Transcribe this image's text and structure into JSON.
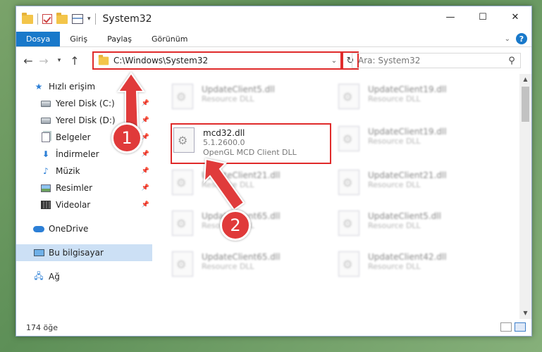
{
  "window": {
    "title": "System32",
    "controls": {
      "minimize": "—",
      "maximize": "☐",
      "close": "✕"
    }
  },
  "ribbon": {
    "tabs": [
      "Dosya",
      "Giriş",
      "Paylaş",
      "Görünüm"
    ],
    "help": "?"
  },
  "address": {
    "path": "C:\\Windows\\System32",
    "search_placeholder": "Ara: System32"
  },
  "sidebar": {
    "quick_access": "Hızlı erişim",
    "pinned": [
      "Yerel Disk (C:)",
      "Yerel Disk (D:)",
      "Belgeler",
      "İndirmeler",
      "Müzik",
      "Resimler",
      "Videolar"
    ],
    "onedrive": "OneDrive",
    "this_pc": "Bu bilgisayar",
    "network": "Ağ"
  },
  "files": {
    "highlighted": {
      "name": "mcd32.dll",
      "version": "5.1.2600.0",
      "description": "OpenGL MCD Client DLL"
    },
    "left_column": [
      {
        "name": "UpdateClient5.dll",
        "type": "Resource DLL"
      },
      {
        "name": "UpdateClient21.dll",
        "type": "Resource DLL"
      },
      {
        "name": "UpdateClient65.dll",
        "type": "Resource DLL"
      },
      {
        "name": "UpdateClient65.dll",
        "type": "Resource DLL"
      }
    ],
    "right_column": [
      {
        "name": "UpdateClient19.dll",
        "type": "Resource DLL"
      },
      {
        "name": "UpdateClient19.dll",
        "type": "Resource DLL"
      },
      {
        "name": "UpdateClient21.dll",
        "type": "Resource DLL"
      },
      {
        "name": "UpdateClient5.dll",
        "type": "Resource DLL"
      },
      {
        "name": "UpdateClient42.dll",
        "type": "Resource DLL"
      }
    ]
  },
  "status": {
    "count": "174 öğe"
  },
  "annotations": {
    "step1": "1",
    "step2": "2",
    "accent": "#e03a3a"
  }
}
